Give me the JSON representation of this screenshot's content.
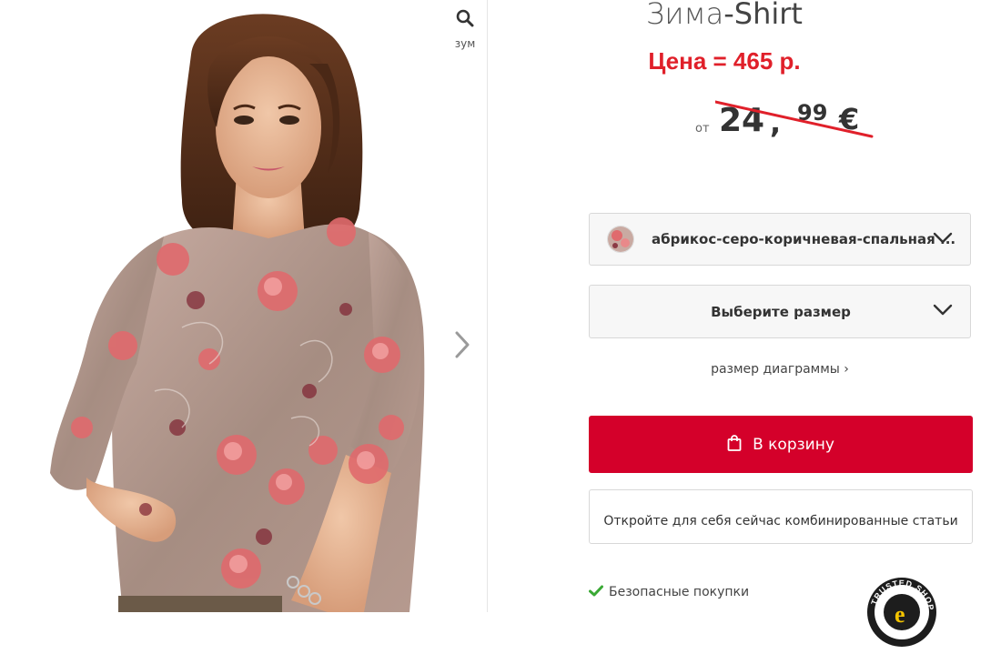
{
  "gallery": {
    "zoom_label": "зум",
    "zoom_icon": "search-icon",
    "next_icon": "chevron-right-icon"
  },
  "product": {
    "title_brand": "Зима",
    "title_rest": "-Shirt",
    "price_rub": "Цена = 465 р.",
    "old_price": {
      "from": "от",
      "integer": "24",
      "comma": ",",
      "cents": "99",
      "currency": "€"
    }
  },
  "color_select": {
    "value": "абрикос-серо-коричневая-спальная ..."
  },
  "size_select": {
    "value": "Выберите размер"
  },
  "size_chart_link": "размер диаграммы ›",
  "cart_button": "В корзину",
  "combo_button": "Откройте для себя сейчас комбинированные статьи",
  "secure_purchase": "Безопасные покупки",
  "trusted_badge": "TRUSTED SHOPS",
  "colors": {
    "accent": "#d4002a",
    "price_red": "#e0202a",
    "check_green": "#3aa935"
  }
}
